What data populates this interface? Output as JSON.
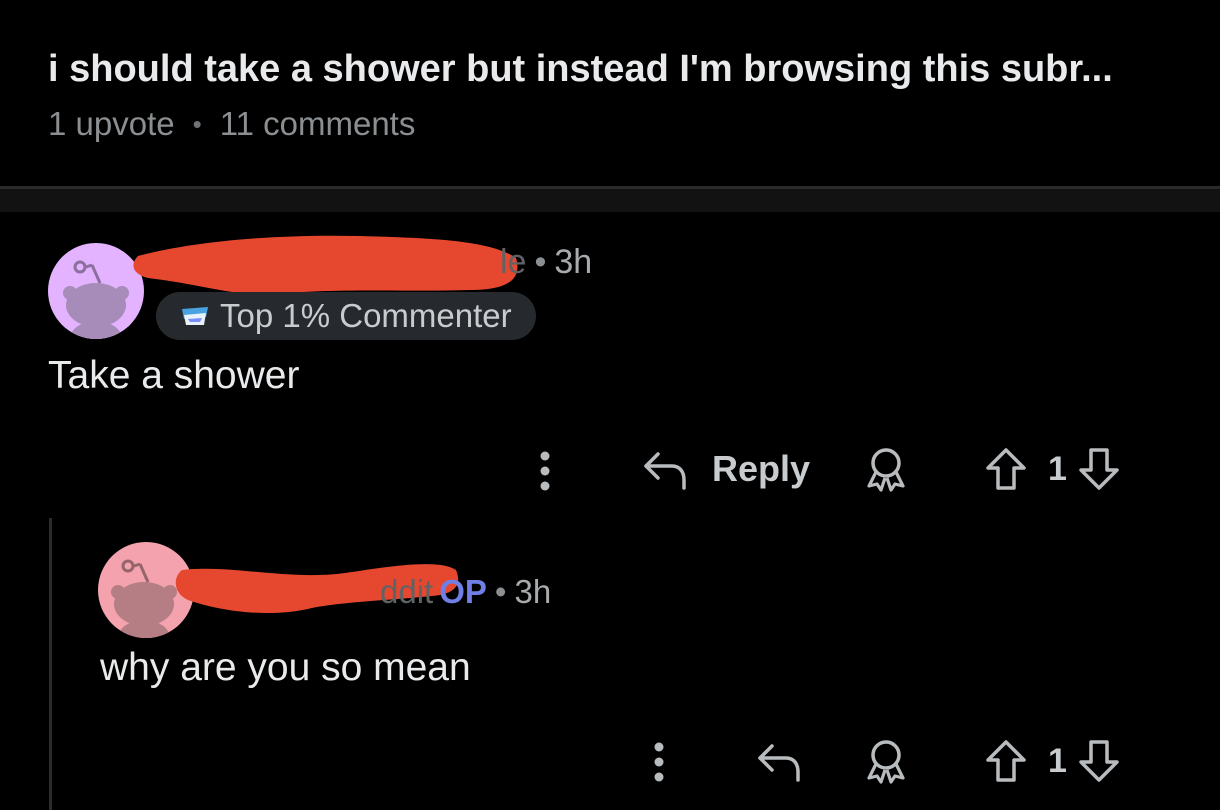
{
  "post": {
    "title": "i should take a shower but instead I'm browsing this subr...",
    "upvotes": "1 upvote",
    "separator": "•",
    "comments": "11 comments"
  },
  "comments": [
    {
      "username_visible_fragment": "le",
      "separator": "•",
      "time": "3h",
      "flair": "Top 1% Commenter",
      "body": "Take a shower",
      "actions": {
        "reply": "Reply",
        "votes": "1"
      },
      "avatar_color": "#e3b3ff"
    },
    {
      "username_visible_fragment": "ddit",
      "op_tag": "OP",
      "separator": "•",
      "time": "3h",
      "body": "why are you so mean",
      "actions": {
        "votes": "1"
      },
      "avatar_color": "#f4a3ae"
    }
  ],
  "colors": {
    "background": "#000000",
    "redaction": "#e5482e",
    "op_tag": "#6f7fe6",
    "muted_text": "#8b8f92"
  },
  "icons": {
    "more": "vertical-dots-icon",
    "reply": "reply-arrow-icon",
    "award": "award-icon",
    "upvote": "upvote-arrow-icon",
    "downvote": "downvote-arrow-icon"
  }
}
